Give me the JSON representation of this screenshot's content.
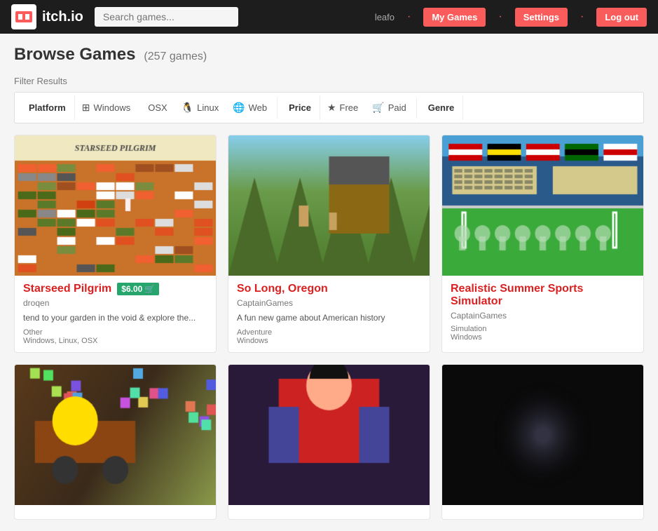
{
  "header": {
    "logo_text": "itch.io",
    "search_placeholder": "Search games...",
    "user": "leafo",
    "my_games_label": "My Games",
    "settings_label": "Settings",
    "logout_label": "Log out"
  },
  "page": {
    "title": "Browse Games",
    "game_count": "(257 games)",
    "filter_label": "Filter Results"
  },
  "filters": {
    "platform_label": "Platform",
    "windows_label": "Windows",
    "osx_label": "OSX",
    "linux_label": "Linux",
    "web_label": "Web",
    "price_label": "Price",
    "free_label": "Free",
    "paid_label": "Paid",
    "genre_label": "Genre"
  },
  "games": [
    {
      "title": "Starseed Pilgrim",
      "price": "$6.00",
      "author": "droqen",
      "description": "tend to your garden in the void & explore the...",
      "tags": "Other",
      "platforms": "Windows, Linux, OSX",
      "thumb_type": "starseed"
    },
    {
      "title": "So Long, Oregon",
      "price": null,
      "author": "CaptainGames",
      "description": "A fun new game about American history",
      "tags": "Adventure",
      "platforms": "Windows",
      "thumb_type": "oregon"
    },
    {
      "title": "Realistic Summer Sports Simulator",
      "price": null,
      "author": "CaptainGames",
      "description": "",
      "tags": "Simulation",
      "platforms": "Windows",
      "thumb_type": "summer"
    },
    {
      "title": "",
      "price": null,
      "author": "",
      "description": "",
      "tags": "",
      "platforms": "",
      "thumb_type": "bottom1"
    },
    {
      "title": "",
      "price": null,
      "author": "",
      "description": "",
      "tags": "",
      "platforms": "",
      "thumb_type": "bottom2"
    },
    {
      "title": "",
      "price": null,
      "author": "",
      "description": "",
      "tags": "",
      "platforms": "",
      "thumb_type": "bottom3"
    }
  ]
}
